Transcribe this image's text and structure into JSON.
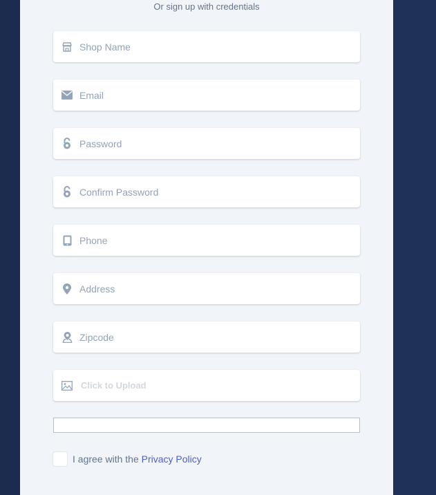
{
  "form": {
    "subtitle": "Or sign up with credentials",
    "fields": [
      {
        "icon": "store-icon",
        "placeholder": "Shop Name"
      },
      {
        "icon": "envelope-icon",
        "placeholder": "Email"
      },
      {
        "icon": "lock-icon",
        "placeholder": "Password"
      },
      {
        "icon": "lock-icon",
        "placeholder": "Confirm Password"
      },
      {
        "icon": "tablet-icon",
        "placeholder": "Phone"
      },
      {
        "icon": "map-pin-icon",
        "placeholder": "Address"
      },
      {
        "icon": "location-person-icon",
        "placeholder": "Zipcode"
      }
    ],
    "upload": {
      "icon": "image-icon",
      "label": "Click to Upload"
    },
    "agree": {
      "text": "I agree with the ",
      "link": "Privacy Policy"
    }
  },
  "colors": {
    "background": "#1c2c4f",
    "card": "#f1f5f9",
    "link": "#4f5fc7",
    "icon": "#94a3b8"
  }
}
